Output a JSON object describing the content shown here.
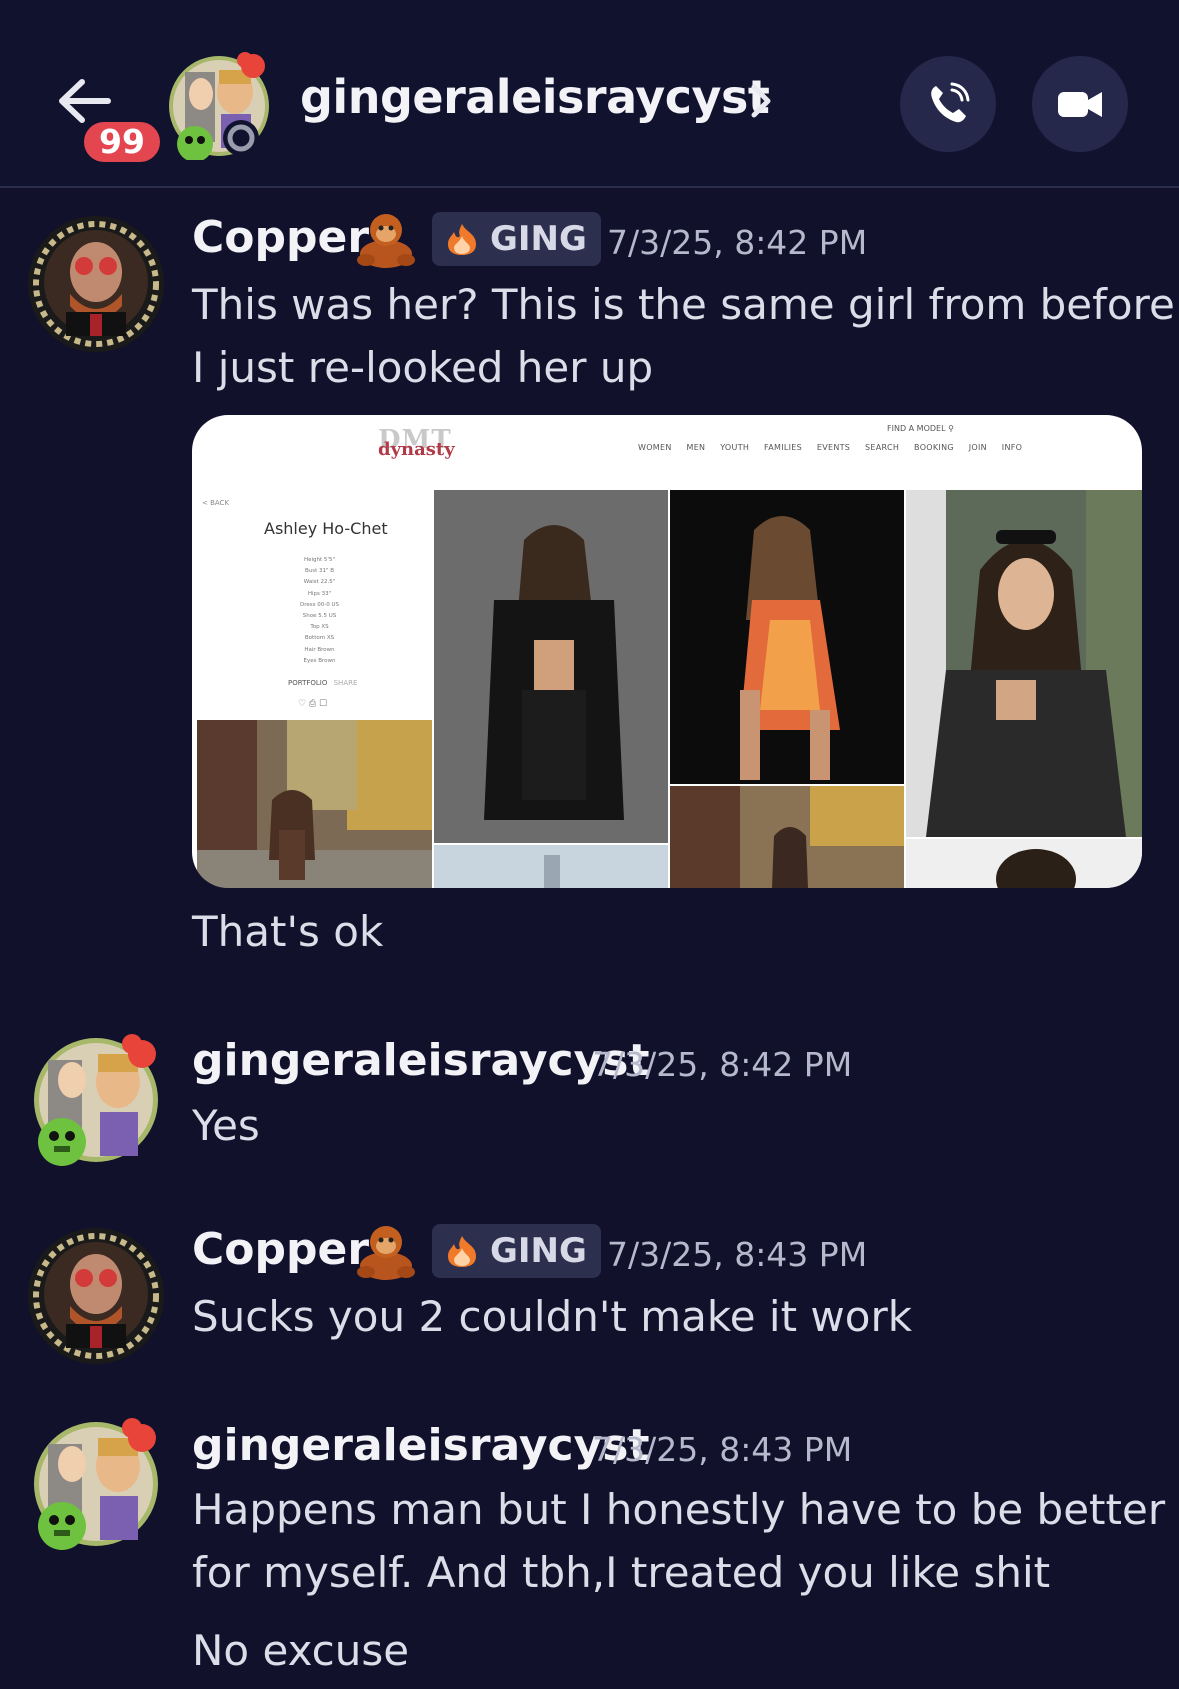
{
  "header": {
    "title": "gingeraleisraycyst",
    "unread_badge": "99"
  },
  "messages": [
    {
      "author": "Copper",
      "tag": "GING",
      "timestamp": "7/3/25, 8:42 PM",
      "lines": [
        "This was her? This is the same girl from before",
        "I just re-looked her up"
      ],
      "followup": "That's ok"
    },
    {
      "author": "gingeraleisraycyst",
      "timestamp": "7/3/25, 8:42 PM",
      "lines": [
        "Yes"
      ]
    },
    {
      "author": "Copper",
      "tag": "GING",
      "timestamp": "7/3/25, 8:43 PM",
      "lines": [
        "Sucks you 2 couldn't make it work"
      ]
    },
    {
      "author": "gingeraleisraycyst",
      "timestamp": "7/3/25, 8:43 PM",
      "lines": [
        "Happens man but I honestly have to be better",
        "for myself. And tbh,I treated you like shit"
      ],
      "followup": "No excuse"
    }
  ],
  "embed": {
    "logo_top": "DMT",
    "logo_main": "dynasty",
    "nav": [
      "WOMEN",
      "MEN",
      "YOUTH",
      "FAMILIES",
      "EVENTS",
      "SEARCH",
      "BOOKING",
      "JOIN",
      "INFO"
    ],
    "find_model": "FIND A MODEL",
    "back": "< BACK",
    "model_name": "Ashley Ho-Chet",
    "stats": [
      "Height 5'5\"",
      "Bust 31\" B",
      "Waist 22.5\"",
      "Hips 33\"",
      "Dress 00-0 US",
      "Shoe 5.5 US",
      "Top XS",
      "Bottom XS",
      "Hair Brown",
      "Eyes Brown"
    ],
    "portfolio": "PORTFOLIO",
    "share": "SHARE"
  },
  "colors": {
    "background": "#11112b",
    "badge": "#e3464f",
    "tag_bg": "#2c2f4d"
  }
}
